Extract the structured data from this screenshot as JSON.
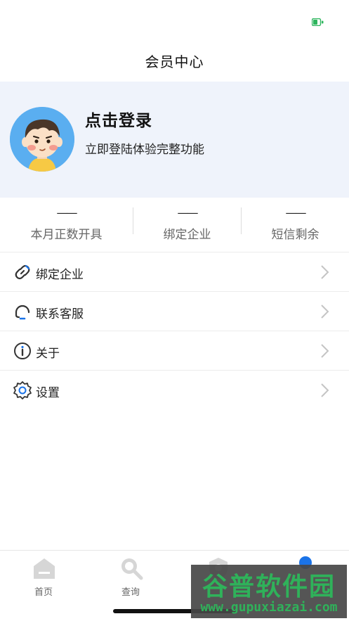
{
  "header": {
    "title": "会员中心"
  },
  "profile": {
    "login_title": "点击登录",
    "login_subtitle": "立即登陆体验完整功能"
  },
  "stats": [
    {
      "value": "——",
      "label": "本月正数开具"
    },
    {
      "value": "——",
      "label": "绑定企业"
    },
    {
      "value": "——",
      "label": "短信剩余"
    }
  ],
  "menu": [
    {
      "label": "绑定企业",
      "icon": "link-icon"
    },
    {
      "label": "联系客服",
      "icon": "headset-icon"
    },
    {
      "label": "关于",
      "icon": "info-icon"
    },
    {
      "label": "设置",
      "icon": "gear-icon"
    }
  ],
  "tabbar": [
    {
      "label": "首页",
      "icon": "home-icon"
    },
    {
      "label": "查询",
      "icon": "search-icon"
    },
    {
      "label": "",
      "icon": "shield-icon"
    },
    {
      "label": "",
      "icon": "member-icon"
    }
  ],
  "watermark": {
    "text": "谷普软件园",
    "url": "www.gupuxiazai.com"
  },
  "colors": {
    "profile_bg": "#eff3fb",
    "avatar_bg": "#5aaef0",
    "battery": "#2db55d",
    "watermark_green": "#2fb25a",
    "active_tab": "#1a73e8"
  }
}
